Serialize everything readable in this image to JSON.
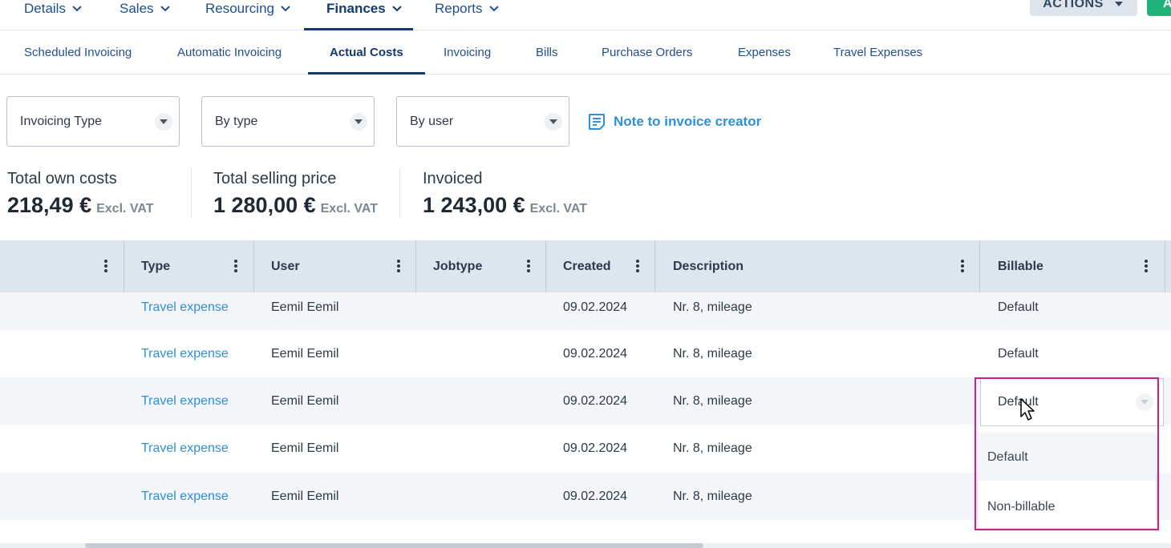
{
  "topnav": {
    "items": [
      {
        "label": "Details",
        "active": false
      },
      {
        "label": "Sales",
        "active": false
      },
      {
        "label": "Resourcing",
        "active": false
      },
      {
        "label": "Finances",
        "active": true
      },
      {
        "label": "Reports",
        "active": false
      }
    ],
    "actions_label": "ACTIONS",
    "green_button_label": "A"
  },
  "subtabs": [
    {
      "label": "Scheduled Invoicing",
      "active": false
    },
    {
      "label": "Automatic Invoicing",
      "active": false
    },
    {
      "label": "Actual Costs",
      "active": true
    },
    {
      "label": "Invoicing",
      "active": false
    },
    {
      "label": "Bills",
      "active": false
    },
    {
      "label": "Purchase Orders",
      "active": false
    },
    {
      "label": "Expenses",
      "active": false
    },
    {
      "label": "Travel Expenses",
      "active": false
    }
  ],
  "filters": {
    "invoicing_type": "Invoicing Type",
    "by_type": "By type",
    "by_user": "By user",
    "note_link": "Note to invoice creator"
  },
  "totals": [
    {
      "label": "Total own costs",
      "value": "218,49 €",
      "suffix": "Excl. VAT"
    },
    {
      "label": "Total selling price",
      "value": "1 280,00 €",
      "suffix": "Excl. VAT"
    },
    {
      "label": "Invoiced",
      "value": "1 243,00 €",
      "suffix": "Excl. VAT"
    }
  ],
  "table": {
    "columns": [
      "Type",
      "User",
      "Jobtype",
      "Created",
      "Description",
      "Billable"
    ],
    "rows": [
      {
        "type": "Travel expense",
        "user": "Eemil Eemil",
        "jobtype": "",
        "created": "09.02.2024",
        "description": "Nr. 8, mileage",
        "billable": "Default"
      },
      {
        "type": "Travel expense",
        "user": "Eemil Eemil",
        "jobtype": "",
        "created": "09.02.2024",
        "description": "Nr. 8, mileage",
        "billable": "Default"
      },
      {
        "type": "Travel expense",
        "user": "Eemil Eemil",
        "jobtype": "",
        "created": "09.02.2024",
        "description": "Nr. 8, mileage",
        "billable": "Default"
      },
      {
        "type": "Travel expense",
        "user": "Eemil Eemil",
        "jobtype": "",
        "created": "09.02.2024",
        "description": "Nr. 8, mileage",
        "billable": ""
      },
      {
        "type": "Travel expense",
        "user": "Eemil Eemil",
        "jobtype": "",
        "created": "09.02.2024",
        "description": "Nr. 8, mileage",
        "billable": ""
      }
    ]
  },
  "billable_dropdown": {
    "selected": "Default",
    "options": [
      "Default",
      "Non-billable"
    ]
  },
  "colors": {
    "nav_text": "#1d4f91",
    "link": "#2f8fd8",
    "header_bg": "#dde5ee",
    "highlight_border": "#d11d8a",
    "green_button": "#1fb27b"
  },
  "icons": [
    "chevron-down-icon",
    "caret-down-icon",
    "note-icon",
    "kebab-menu-icon",
    "mouse-cursor-icon"
  ]
}
